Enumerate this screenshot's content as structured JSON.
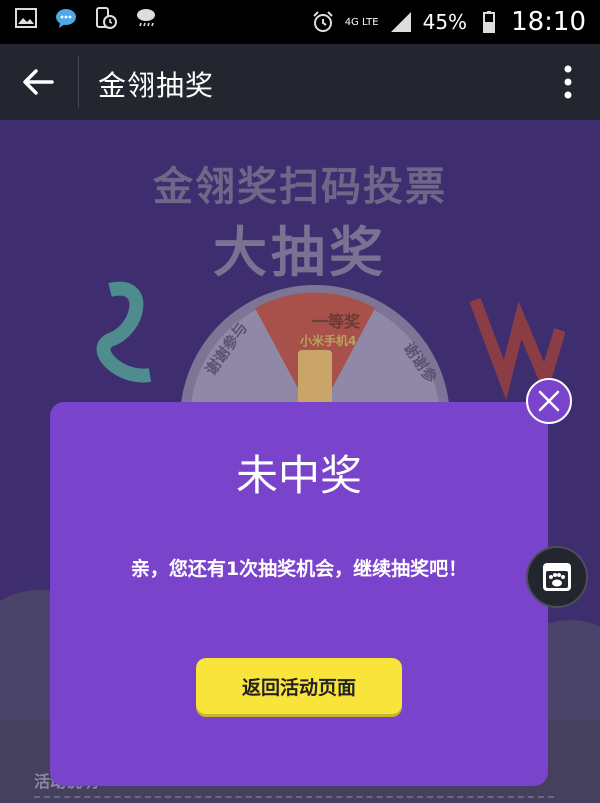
{
  "status_bar": {
    "network": "4G LTE",
    "battery": "45%",
    "time": "18:10"
  },
  "app_bar": {
    "title": "金翎抽奖"
  },
  "page": {
    "hero_line1": "金翎奖扫码投票",
    "hero_line2": "大抽奖",
    "wheel_segments": [
      "谢谢参与",
      "一等奖",
      "小米手机4",
      "谢谢参"
    ],
    "activity_label": "活动说明"
  },
  "dialog": {
    "title": "未中奖",
    "message": "亲，您还有1次抽奖机会，继续抽奖吧！",
    "button_label": "返回活动页面"
  },
  "colors": {
    "dialog_bg": "#7a43cc",
    "button_bg": "#f8e43b",
    "appbar_bg": "#23262f",
    "wheel_red": "#e0453a"
  }
}
